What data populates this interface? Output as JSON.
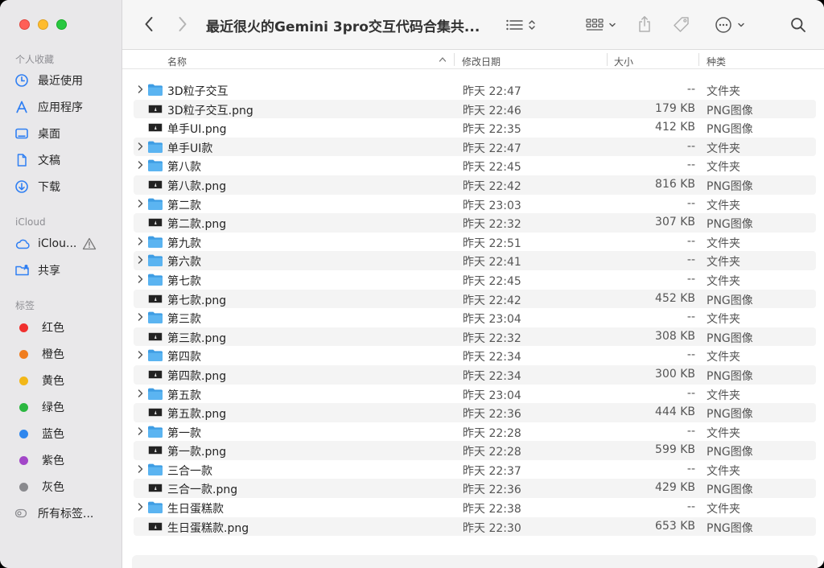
{
  "window": {
    "title": "最近很火的Gemini 3pro交互代码合集共..."
  },
  "sidebar": {
    "favorites_header": "个人收藏",
    "favorites": [
      {
        "label": "最近使用",
        "icon": "clock-icon"
      },
      {
        "label": "应用程序",
        "icon": "applications-icon"
      },
      {
        "label": "桌面",
        "icon": "desktop-icon"
      },
      {
        "label": "文稿",
        "icon": "document-icon"
      },
      {
        "label": "下载",
        "icon": "download-icon"
      }
    ],
    "icloud_header": "iCloud",
    "icloud": [
      {
        "label": "iClou...",
        "icon": "cloud-icon"
      },
      {
        "label": "共享",
        "icon": "shared-folder-icon"
      }
    ],
    "tags_header": "标签",
    "tags": [
      {
        "label": "红色",
        "color": "#f0302e"
      },
      {
        "label": "橙色",
        "color": "#f07d1f"
      },
      {
        "label": "黄色",
        "color": "#f2b718"
      },
      {
        "label": "绿色",
        "color": "#2bb740"
      },
      {
        "label": "蓝色",
        "color": "#2f87ee"
      },
      {
        "label": "紫色",
        "color": "#a246c8"
      },
      {
        "label": "灰色",
        "color": "#8a8a8e"
      }
    ],
    "all_tags": "所有标签..."
  },
  "columns": {
    "name": "名称",
    "date": "修改日期",
    "size": "大小",
    "kind": "种类"
  },
  "files": [
    {
      "name": "3D粒子交互",
      "date": "昨天 22:47",
      "size": "--",
      "kind": "文件夹",
      "type": "folder"
    },
    {
      "name": "3D粒子交互.png",
      "date": "昨天 22:46",
      "size": "179 KB",
      "kind": "PNG图像",
      "type": "image"
    },
    {
      "name": "单手UI.png",
      "date": "昨天 22:35",
      "size": "412 KB",
      "kind": "PNG图像",
      "type": "image"
    },
    {
      "name": "单手UI款",
      "date": "昨天 22:47",
      "size": "--",
      "kind": "文件夹",
      "type": "folder"
    },
    {
      "name": "第八款",
      "date": "昨天 22:45",
      "size": "--",
      "kind": "文件夹",
      "type": "folder"
    },
    {
      "name": "第八款.png",
      "date": "昨天 22:42",
      "size": "816 KB",
      "kind": "PNG图像",
      "type": "image"
    },
    {
      "name": "第二款",
      "date": "昨天 23:03",
      "size": "--",
      "kind": "文件夹",
      "type": "folder"
    },
    {
      "name": "第二款.png",
      "date": "昨天 22:32",
      "size": "307 KB",
      "kind": "PNG图像",
      "type": "image"
    },
    {
      "name": "第九款",
      "date": "昨天 22:51",
      "size": "--",
      "kind": "文件夹",
      "type": "folder"
    },
    {
      "name": "第六款",
      "date": "昨天 22:41",
      "size": "--",
      "kind": "文件夹",
      "type": "folder"
    },
    {
      "name": "第七款",
      "date": "昨天 22:45",
      "size": "--",
      "kind": "文件夹",
      "type": "folder"
    },
    {
      "name": "第七款.png",
      "date": "昨天 22:42",
      "size": "452 KB",
      "kind": "PNG图像",
      "type": "image"
    },
    {
      "name": "第三款",
      "date": "昨天 23:04",
      "size": "--",
      "kind": "文件夹",
      "type": "folder"
    },
    {
      "name": "第三款.png",
      "date": "昨天 22:32",
      "size": "308 KB",
      "kind": "PNG图像",
      "type": "image"
    },
    {
      "name": "第四款",
      "date": "昨天 22:34",
      "size": "--",
      "kind": "文件夹",
      "type": "folder"
    },
    {
      "name": "第四款.png",
      "date": "昨天 22:34",
      "size": "300 KB",
      "kind": "PNG图像",
      "type": "image"
    },
    {
      "name": "第五款",
      "date": "昨天 23:04",
      "size": "--",
      "kind": "文件夹",
      "type": "folder"
    },
    {
      "name": "第五款.png",
      "date": "昨天 22:36",
      "size": "444 KB",
      "kind": "PNG图像",
      "type": "image"
    },
    {
      "name": "第一款",
      "date": "昨天 22:28",
      "size": "--",
      "kind": "文件夹",
      "type": "folder"
    },
    {
      "name": "第一款.png",
      "date": "昨天 22:28",
      "size": "599 KB",
      "kind": "PNG图像",
      "type": "image"
    },
    {
      "name": "三合一款",
      "date": "昨天 22:37",
      "size": "--",
      "kind": "文件夹",
      "type": "folder"
    },
    {
      "name": "三合一款.png",
      "date": "昨天 22:36",
      "size": "429 KB",
      "kind": "PNG图像",
      "type": "image"
    },
    {
      "name": "生日蛋糕款",
      "date": "昨天 22:38",
      "size": "--",
      "kind": "文件夹",
      "type": "folder"
    },
    {
      "name": "生日蛋糕款.png",
      "date": "昨天 22:30",
      "size": "653 KB",
      "kind": "PNG图像",
      "type": "image"
    }
  ],
  "colors": {
    "folder": "#5bb4f1",
    "folder_dark": "#3e9de4",
    "accent": "#2f7ff3"
  }
}
